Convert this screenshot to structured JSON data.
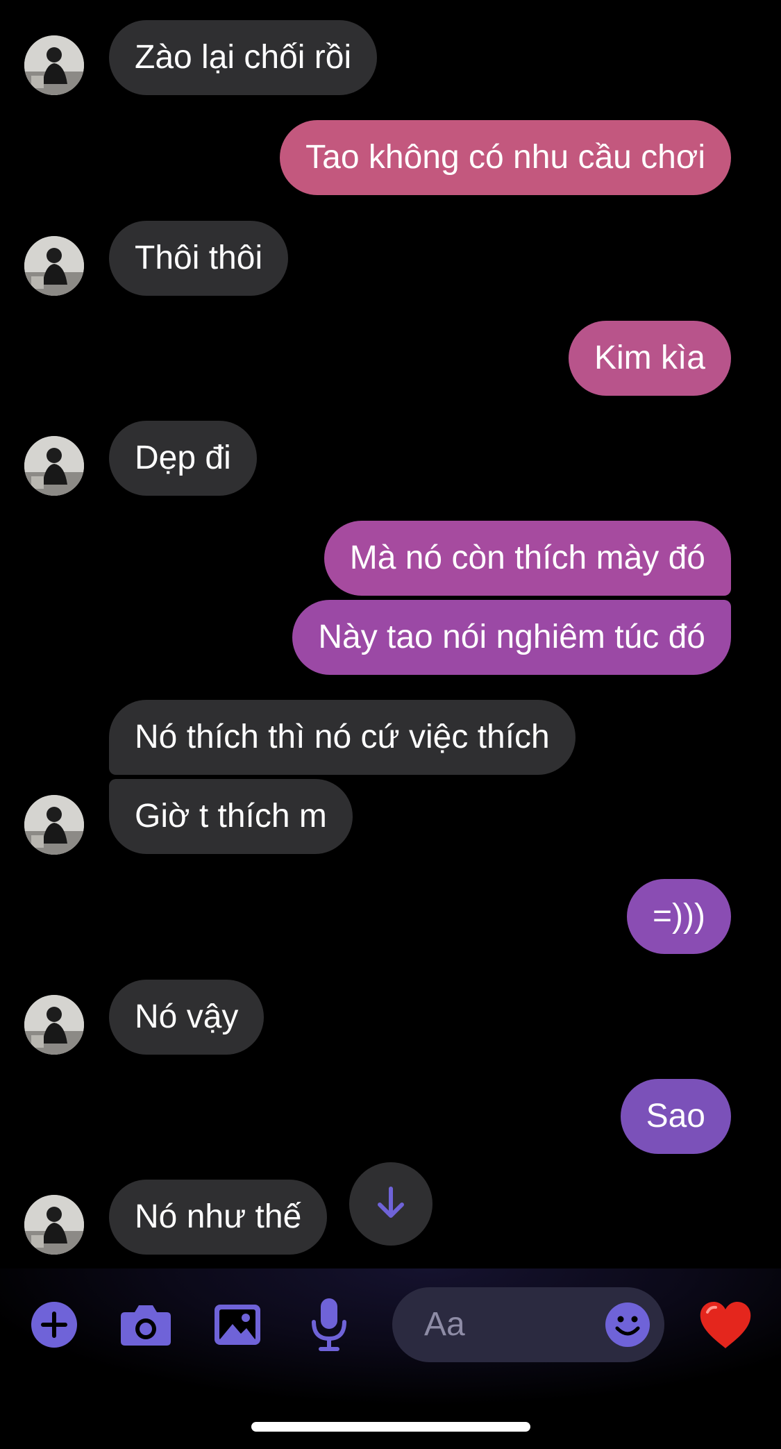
{
  "conversation": {
    "messages": [
      {
        "side": "in",
        "text": "Zào lại chối rồi"
      },
      {
        "side": "out",
        "text": "Tao không có nhu cầu chơi"
      },
      {
        "side": "in",
        "text": "Thôi thôi"
      },
      {
        "side": "out",
        "text": "Kim kìa"
      },
      {
        "side": "in",
        "text": "Dẹp đi"
      },
      {
        "side": "out",
        "text": "Mà nó còn thích mày đó"
      },
      {
        "side": "out",
        "text": "Này tao nói nghiêm túc đó"
      },
      {
        "side": "in",
        "text": "Nó thích thì nó cứ việc thích"
      },
      {
        "side": "in",
        "text": "Giờ t thích m"
      },
      {
        "side": "out",
        "text": "=)))"
      },
      {
        "side": "in",
        "text": "Nó vậy"
      },
      {
        "side": "out",
        "text": "Sao"
      },
      {
        "side": "in",
        "text": "Nó như thế"
      }
    ]
  },
  "composer": {
    "placeholder": "Aa",
    "tools": [
      "plus-icon",
      "camera-icon",
      "photo-icon",
      "microphone-icon"
    ],
    "emoji_icon": "smiley-icon",
    "send_icon": "heart-icon"
  },
  "colors": {
    "incoming_bubble": "#2f2f31",
    "outgoing_gradient_top": "#c3587e",
    "outgoing_gradient_bottom": "#7751b8",
    "accent": "#6f63d8",
    "heart": "#e4261d"
  }
}
